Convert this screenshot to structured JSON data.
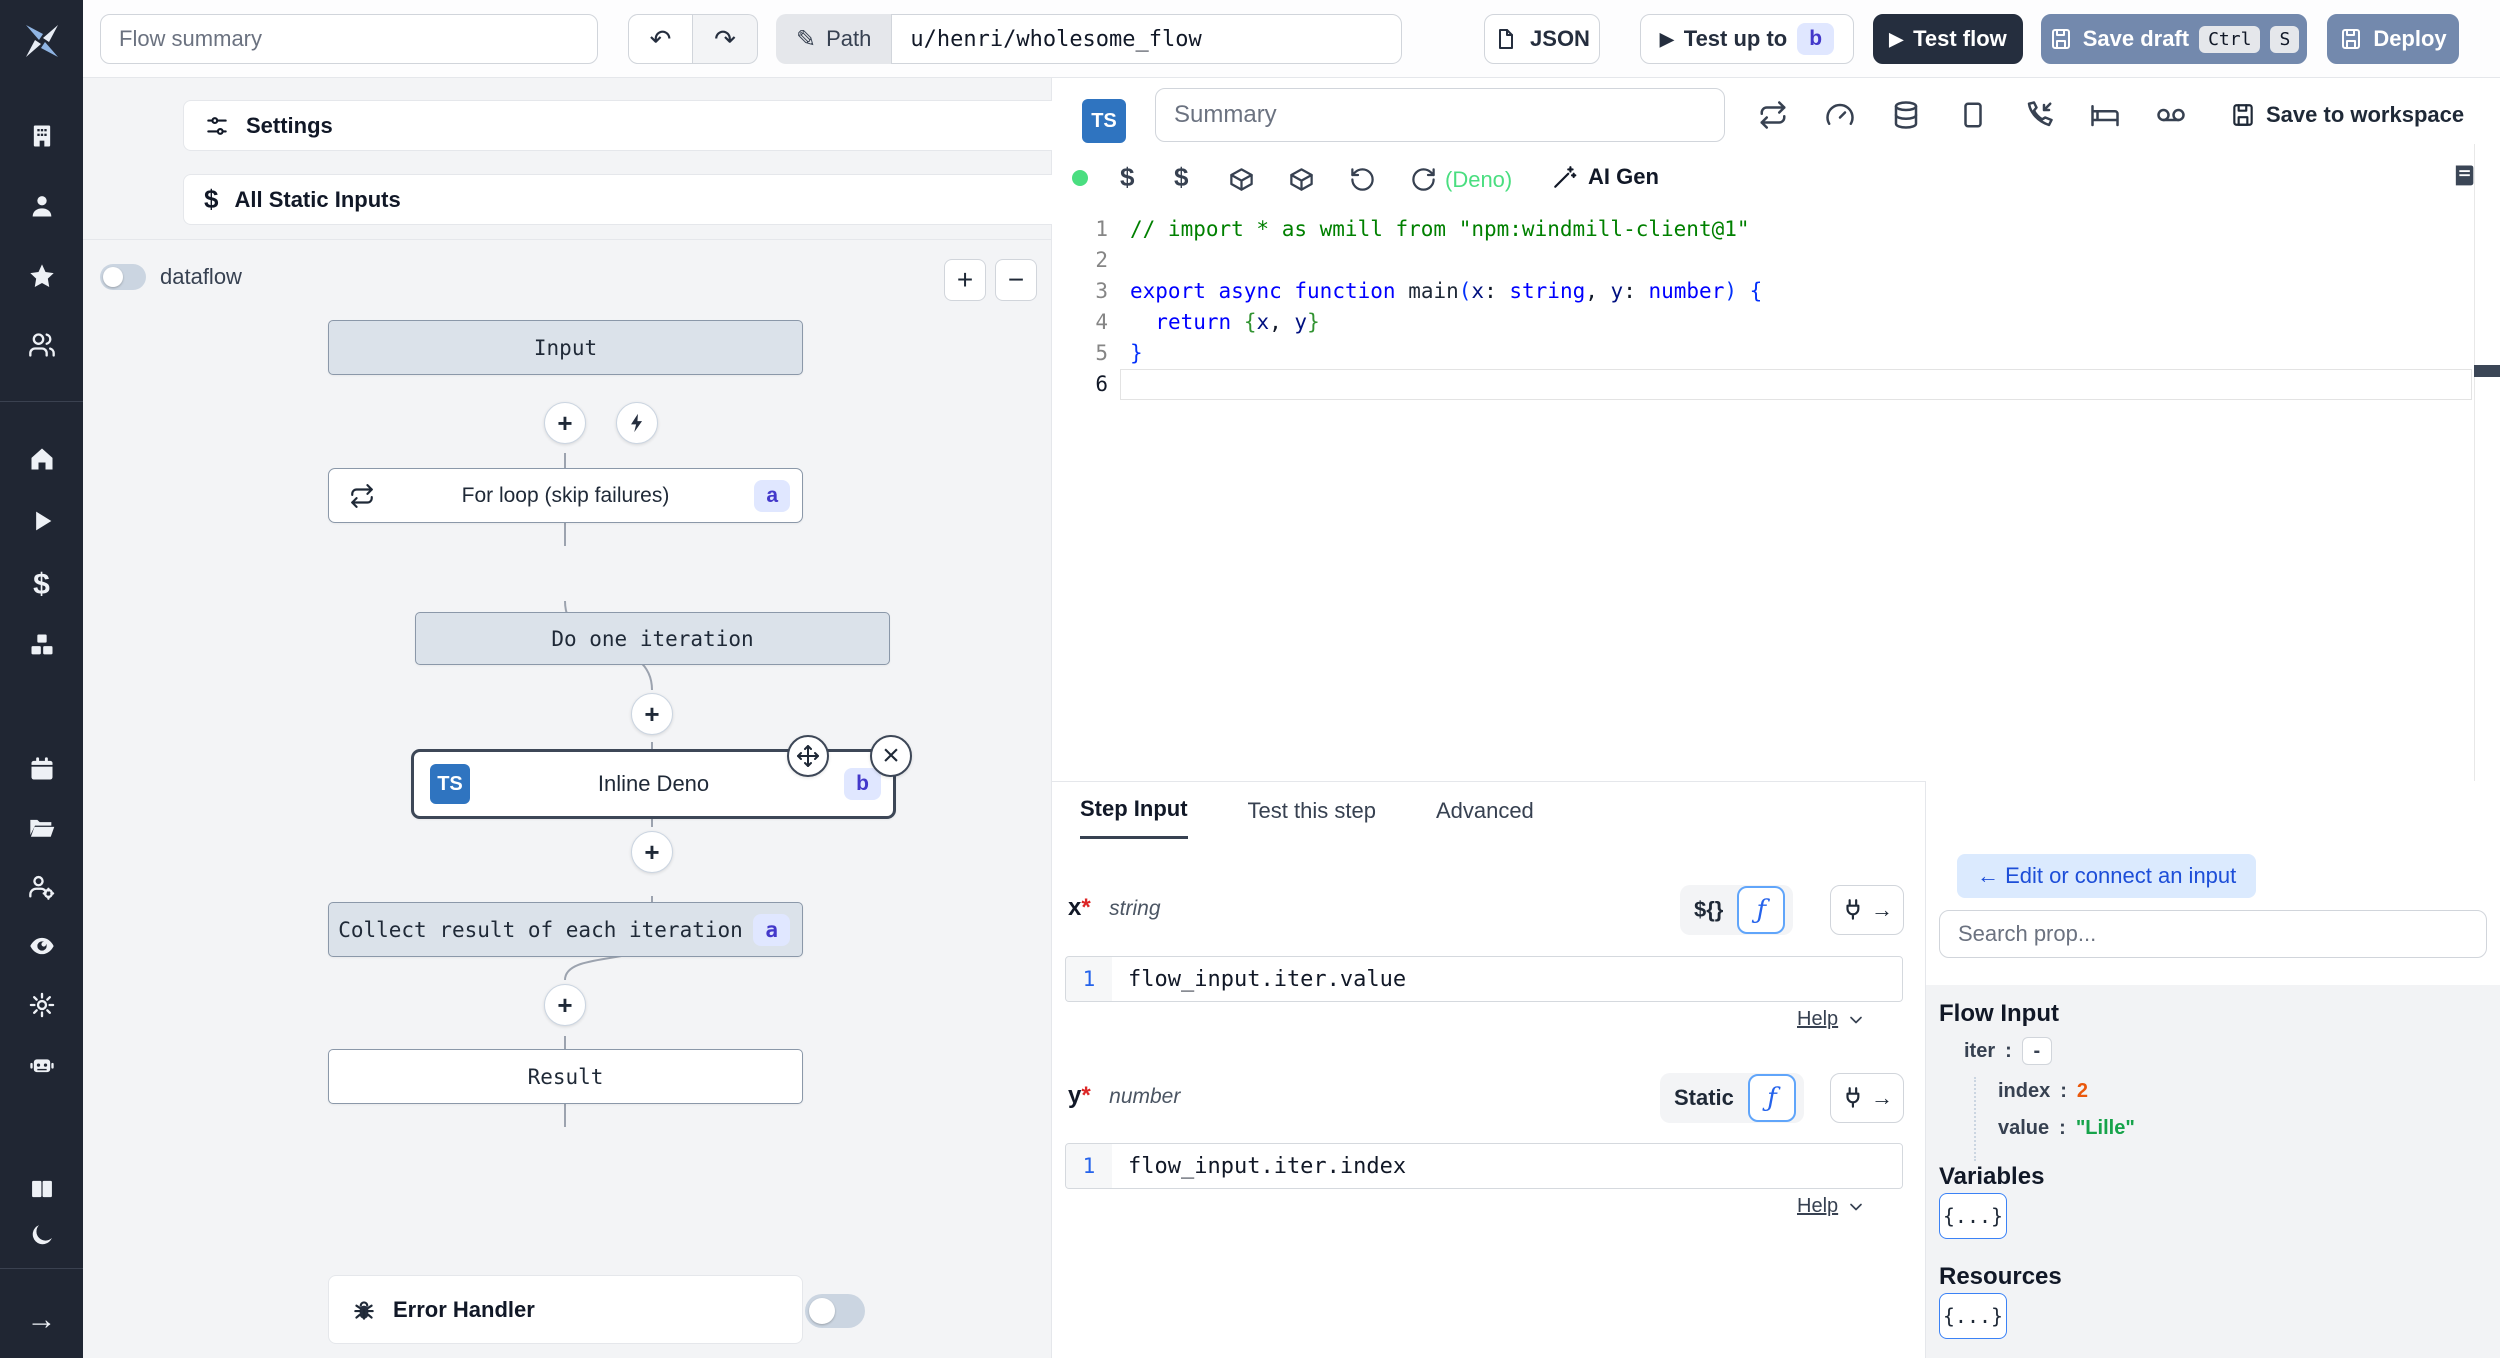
{
  "topbar": {
    "flow_summary_placeholder": "Flow summary",
    "undo_glyph": "↶",
    "redo_glyph": "↷",
    "path_label": "Path",
    "path_value": "u/henri/wholesome_flow",
    "json_label": "JSON",
    "test_up_to_label": "Test up to",
    "test_up_to_badge": "b",
    "test_flow_label": "Test flow",
    "save_draft_label": "Save draft",
    "kbd_ctrl": "Ctrl",
    "kbd_s": "S",
    "deploy_label": "Deploy"
  },
  "sidebar": {
    "icons": [
      "windmill-logo",
      "building",
      "user",
      "star",
      "users",
      "home",
      "play",
      "dollar",
      "boxes",
      "calendar",
      "folder-open",
      "users-cog",
      "eye",
      "gear",
      "bot",
      "book",
      "moon",
      "arrow-right"
    ]
  },
  "left_panel": {
    "settings_label": "Settings",
    "all_static_inputs_label": "All Static Inputs",
    "dataflow_label": "dataflow",
    "zoom_in_label": "+",
    "zoom_out_label": "−"
  },
  "graph": {
    "nodes": {
      "input": {
        "label": "Input"
      },
      "forloop": {
        "label": "For loop (skip failures)",
        "badge": "a"
      },
      "iteration": {
        "label": "Do one iteration"
      },
      "inline": {
        "label": "Inline Deno",
        "badge": "b",
        "lang": "TS"
      },
      "collect": {
        "label": "Collect result of each iteration",
        "badge": "a"
      },
      "result": {
        "label": "Result"
      }
    },
    "error_handler_label": "Error Handler",
    "plus_glyph": "+",
    "close_glyph": "×"
  },
  "editor": {
    "lang_badge": "TS",
    "summary_placeholder": "Summary",
    "save_to_workspace_label": "Save to workspace",
    "runtime_label": "(Deno)",
    "ai_gen_label": "AI Gen",
    "dollar_glyph": "$",
    "code_lines": [
      [
        {
          "t": "// import * as wmill from \"npm:windmill-client@1\"",
          "c": "cmt"
        }
      ],
      [],
      [
        {
          "t": "export",
          "c": "kw"
        },
        {
          "t": " "
        },
        {
          "t": "async",
          "c": "kw"
        },
        {
          "t": " "
        },
        {
          "t": "function",
          "c": "kw"
        },
        {
          "t": " main",
          "c": "id"
        },
        {
          "t": "(",
          "c": "b1"
        },
        {
          "t": "x",
          "c": "pm"
        },
        {
          "t": ": ",
          "c": "pl"
        },
        {
          "t": "string",
          "c": "ty"
        },
        {
          "t": ", ",
          "c": "pl"
        },
        {
          "t": "y",
          "c": "pm"
        },
        {
          "t": ": ",
          "c": "pl"
        },
        {
          "t": "number",
          "c": "ty"
        },
        {
          "t": ")",
          "c": "b1"
        },
        {
          "t": " "
        },
        {
          "t": "{",
          "c": "b1"
        }
      ],
      [
        {
          "t": "  "
        },
        {
          "t": "return",
          "c": "kw"
        },
        {
          "t": " "
        },
        {
          "t": "{",
          "c": "b2"
        },
        {
          "t": "x",
          "c": "pm"
        },
        {
          "t": ", ",
          "c": "pl"
        },
        {
          "t": "y",
          "c": "pm"
        },
        {
          "t": "}",
          "c": "b2"
        }
      ],
      [
        {
          "t": "}",
          "c": "b1"
        }
      ],
      []
    ]
  },
  "step_panel": {
    "tabs": [
      {
        "label": "Step Input"
      },
      {
        "label": "Test this step"
      },
      {
        "label": "Advanced"
      }
    ],
    "fn_icon": "ƒ",
    "fields": [
      {
        "name": "x",
        "required": "*",
        "type": "string",
        "mode": "${}",
        "line": "1",
        "expr": "flow_input.iter.value",
        "help_label": "Help"
      },
      {
        "name": "y",
        "required": "*",
        "type": "number",
        "mode": "Static",
        "line": "1",
        "expr": "flow_input.iter.index",
        "help_label": "Help"
      }
    ]
  },
  "connect_panel": {
    "back_label": "← Edit or connect an input",
    "search_placeholder": "Search prop...",
    "flow_input_title": "Flow Input",
    "tree": [
      {
        "key": "iter",
        "sep": ":",
        "value": "-"
      },
      {
        "key": "index",
        "sep": ":",
        "value": "2"
      },
      {
        "key": "value",
        "sep": ":",
        "value": "\"Lille\""
      }
    ],
    "variables_title": "Variables",
    "variables_button_label": "{...}",
    "resources_title": "Resources",
    "resources_button_label": "{...}"
  },
  "colors": {
    "rail_bg": "#202633",
    "ts_blue": "#2f74c0",
    "indigo_badge_bg": "#e0e7ff",
    "indigo_badge_text": "#4338ca",
    "save_button_bg": "#7389ad",
    "dark_button_bg": "#252e3e",
    "green_accent": "#4ade80",
    "number_value": "#ea580c",
    "string_value": "#16a34a",
    "node_fill": "#dbe2ea"
  }
}
